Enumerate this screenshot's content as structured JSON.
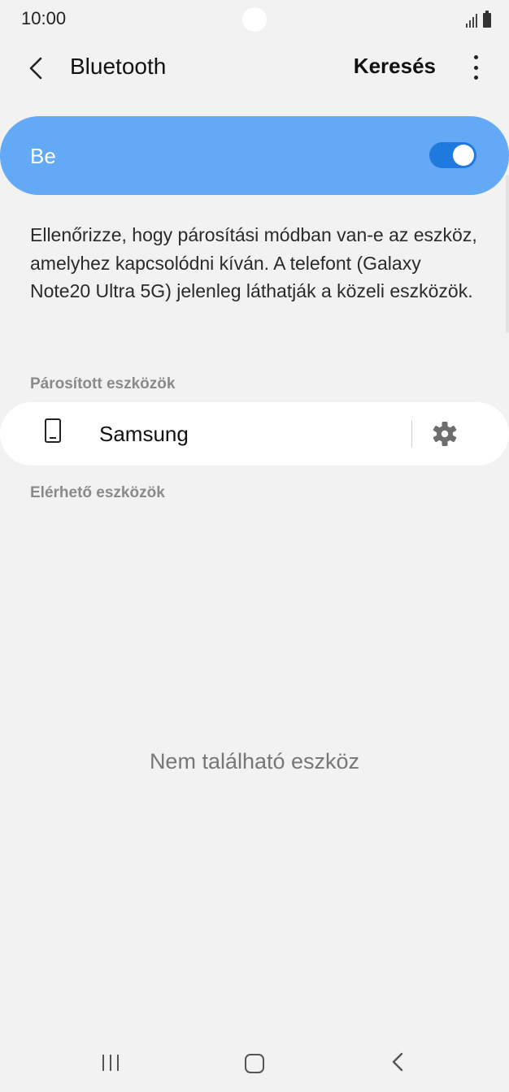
{
  "status_bar": {
    "time": "10:00",
    "icons": [
      "signal-icon",
      "battery-icon"
    ]
  },
  "app_bar": {
    "back_icon": "chevron-left-icon",
    "title": "Bluetooth",
    "search_label": "Keresés",
    "more_icon": "more-vertical-icon"
  },
  "bluetooth_toggle": {
    "label": "Be",
    "state": true,
    "accent_color": "#64a9f5",
    "switch_color": "#1f7ae0"
  },
  "description": "Ellenőrizze, hogy párosítási módban van-e az eszköz, amelyhez kapcsolódni kíván. A telefont (Galaxy Note20 Ultra 5G) jelenleg láthatják a közeli eszközök.",
  "paired": {
    "header": "Párosított eszközök",
    "devices": [
      {
        "name": "Samsung",
        "icon": "phone-icon",
        "settings_icon": "gear-icon"
      }
    ]
  },
  "available": {
    "header": "Elérhető eszközök",
    "empty_message": "Nem található eszköz"
  },
  "nav_bar": {
    "recent_icon": "recent-apps-icon",
    "home_icon": "home-icon",
    "back_icon": "back-icon"
  }
}
